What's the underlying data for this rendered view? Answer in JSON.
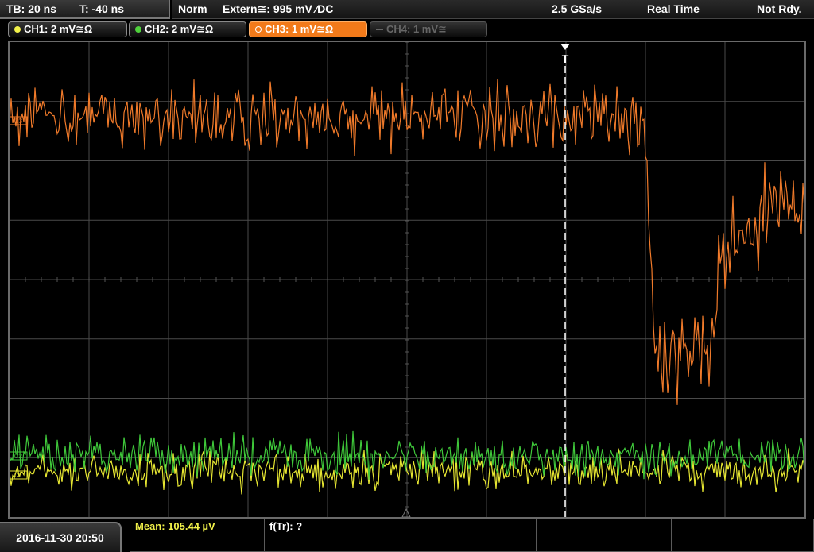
{
  "timebase": {
    "tb": "TB: 20 ns",
    "t": "T: -40 ns"
  },
  "trigger": {
    "mode": "Norm",
    "source": "Extern≅: 995 mV ⁄DC",
    "sample_rate": "2.5 GSa/s",
    "acq_mode": "Real Time",
    "state": "Not Rdy."
  },
  "channels": [
    {
      "label": "CH1: 2 mV≅Ω",
      "color": "#e8e84a",
      "state": "on"
    },
    {
      "label": "CH2: 2 mV≅Ω",
      "color": "#4fd23c",
      "state": "on"
    },
    {
      "label": "CH3: 1 mV≅Ω",
      "color": "#f27a1a",
      "state": "active"
    },
    {
      "label": "CH4: 1 mV≅",
      "color": "#666666",
      "state": "off"
    }
  ],
  "markers": {
    "ch3_ref": "C3",
    "ch1_ref": "C1",
    "ch2_ref": "C2",
    "trigger": "T"
  },
  "measurements": {
    "mean": "Mean: 105.44 µV",
    "freq": "f(Tr): ?"
  },
  "datetime": "2016-11-30 20:50",
  "colors": {
    "grid": "#4a4a4a",
    "ch3_trace": "#f07a2a",
    "ch2_trace": "#3fc83a",
    "ch1_trace": "#e6e632",
    "trigger_line": "#ffffff"
  }
}
